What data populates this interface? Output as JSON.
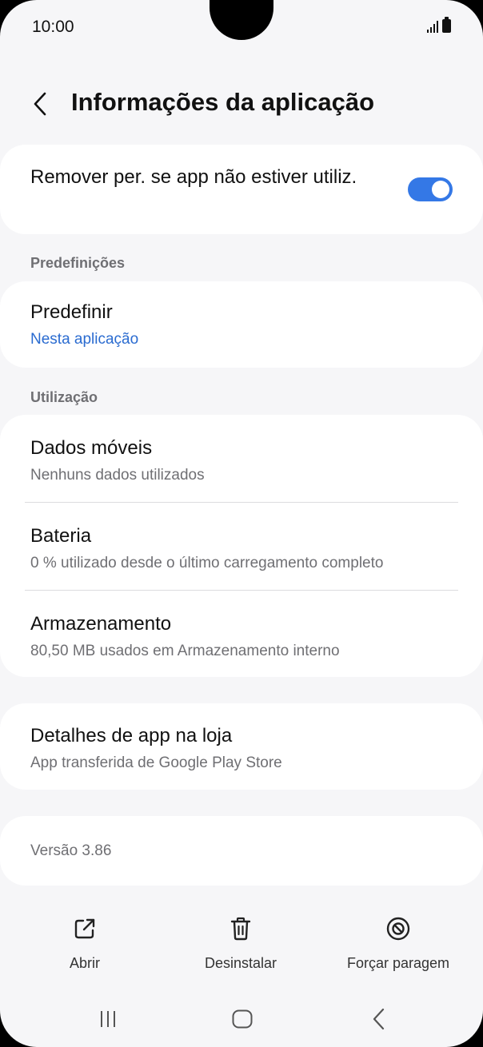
{
  "status_bar": {
    "time": "10:00"
  },
  "header": {
    "title": "Informações da aplicação"
  },
  "remove_permissions": {
    "label": "Remover per. se app não estiver utiliz.",
    "enabled": true
  },
  "sections": {
    "defaults_label": "Predefinições",
    "usage_label": "Utilização"
  },
  "defaults": {
    "title": "Predefinir",
    "subtitle": "Nesta aplicação"
  },
  "usage": {
    "mobile_data": {
      "title": "Dados móveis",
      "subtitle": "Nenhuns dados utilizados"
    },
    "battery": {
      "title": "Bateria",
      "subtitle": "0 % utilizado desde o último carregamento completo"
    },
    "storage": {
      "title": "Armazenamento",
      "subtitle": "80,50 MB usados em Armazenamento interno"
    }
  },
  "store_details": {
    "title": "Detalhes de app na loja",
    "subtitle": "App transferida de Google Play Store"
  },
  "version": {
    "text": "Versão 3.86"
  },
  "actions": {
    "open": "Abrir",
    "uninstall": "Desinstalar",
    "force_stop": "Forçar paragem"
  },
  "icons": {
    "back": "chevron-left-icon",
    "open": "external-link-icon",
    "uninstall": "trash-icon",
    "force_stop": "block-icon"
  },
  "colors": {
    "accent": "#3478e6",
    "link": "#2a6bd0",
    "background": "#f6f6f8"
  }
}
